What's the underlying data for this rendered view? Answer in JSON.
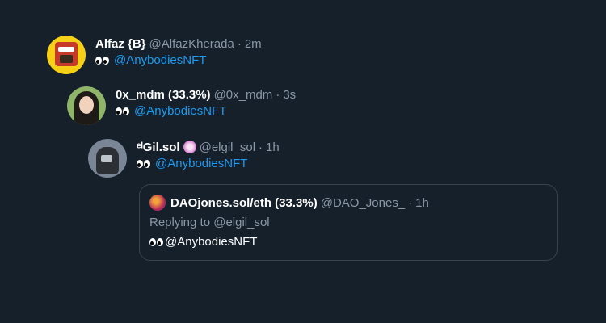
{
  "tweets": [
    {
      "display_name": "Alfaz {B}",
      "handle": "@AlfazKherada",
      "separator": "·",
      "time": "2m",
      "mention": "@AnybodiesNFT"
    },
    {
      "display_name": "0x_mdm (33.3%)",
      "handle": "@0x_mdm",
      "separator": "·",
      "time": "3s",
      "mention": "@AnybodiesNFT"
    },
    {
      "display_name": "ᵉˡGil.sol",
      "handle": "@elgil_sol",
      "separator": "·",
      "time": "1h",
      "mention": "@AnybodiesNFT"
    }
  ],
  "quote": {
    "display_name": "DAOjones.sol/eth (33.3%)",
    "handle": "@DAO_Jones_",
    "separator": "·",
    "time": "1h",
    "replying": "Replying to @elgil_sol",
    "text": "@AnybodiesNFT"
  },
  "icons": {
    "eyes": "eyes-emoji",
    "badge": "flower-badge-icon"
  },
  "colors": {
    "background": "#15202b",
    "mention": "#1d9bf0",
    "muted": "#8b98a5",
    "border": "#38444d"
  }
}
